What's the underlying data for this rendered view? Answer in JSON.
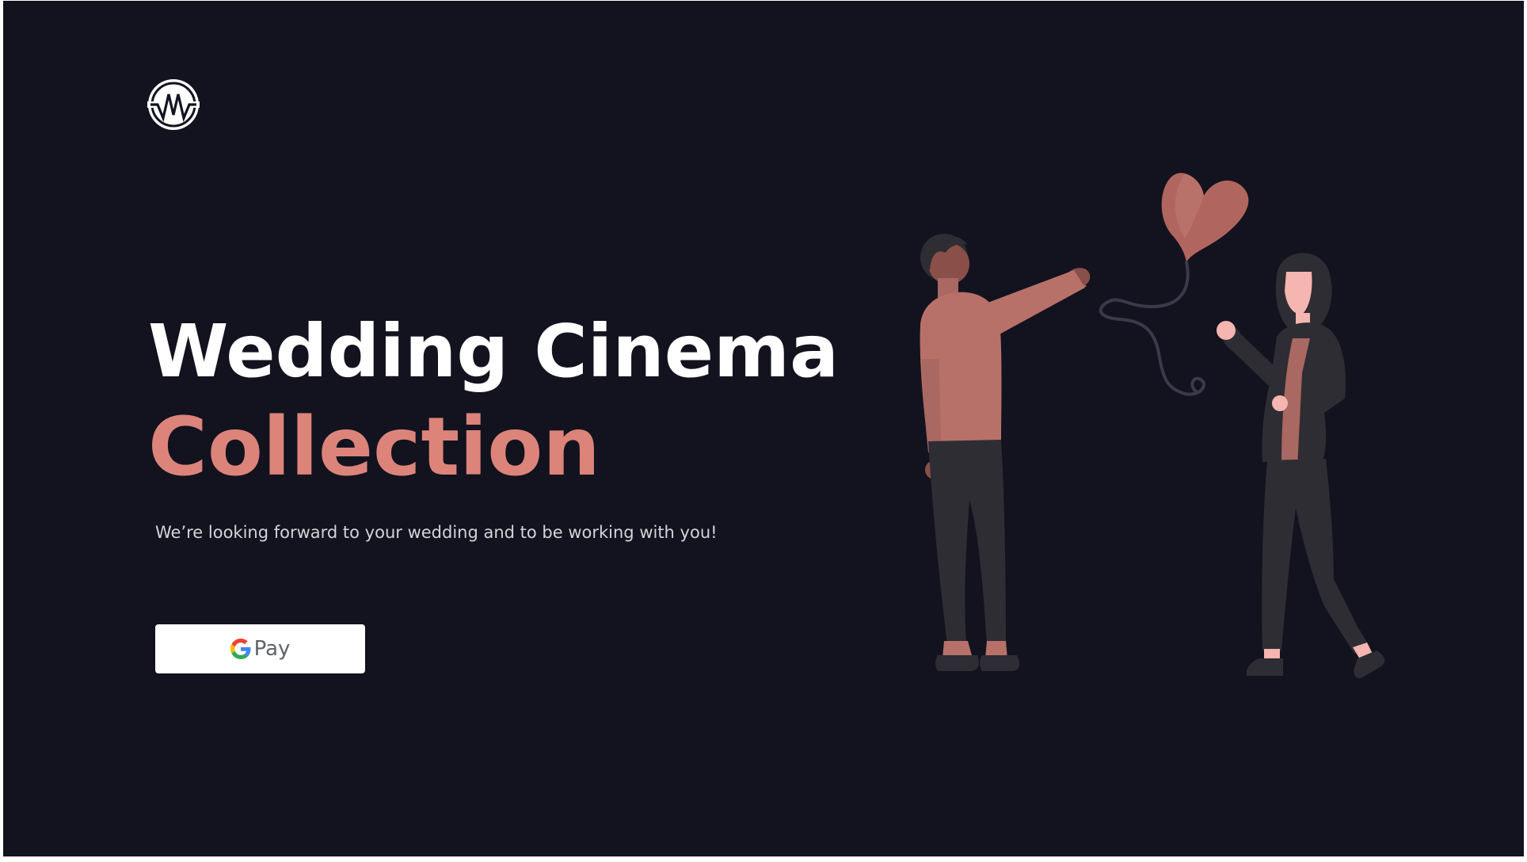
{
  "brand": {
    "logo_icon": "w-circle-logo-icon"
  },
  "hero": {
    "title_line1": "Wedding Cinema",
    "title_line2": "Collection",
    "subtitle": "We’re looking forward to your wedding and to be working with you!"
  },
  "payment": {
    "button_label": "Pay",
    "button_icon": "google-g-icon"
  },
  "illustration": {
    "icon": "couple-with-heart-balloon-illustration"
  },
  "colors": {
    "background": "#12131f",
    "accent": "#dc847a",
    "title": "#ffffff",
    "subtitle": "#d4d4d8",
    "figure_top": "#b87169",
    "figure_dark": "#2e2d33",
    "skin_light": "#f5b5b0"
  }
}
